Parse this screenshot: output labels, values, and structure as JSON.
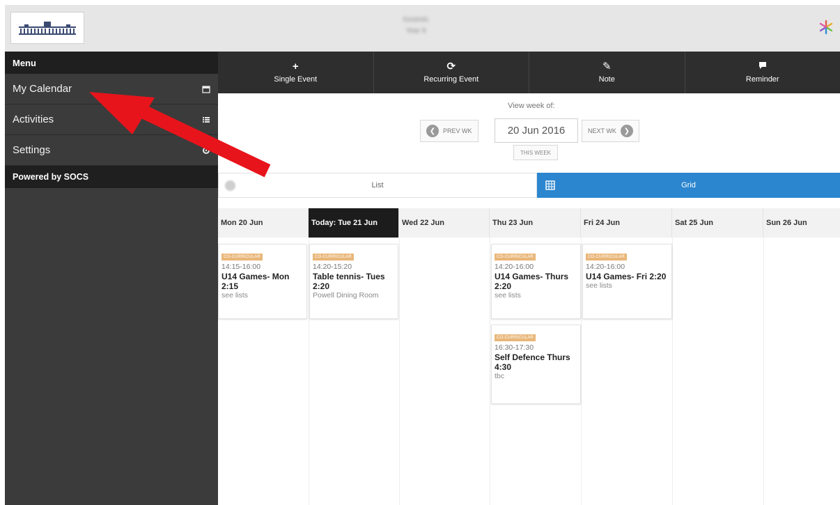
{
  "header": {
    "school_line1": "Kestrels",
    "school_line2": "Year 9"
  },
  "sidebar": {
    "menu_label": "Menu",
    "items": [
      {
        "label": "My Calendar",
        "icon": "calendar-icon"
      },
      {
        "label": "Activities",
        "icon": "list-icon"
      },
      {
        "label": "Settings",
        "icon": "gear-icon"
      }
    ],
    "powered_by": "Powered by SOCS"
  },
  "toolbar": {
    "items": [
      {
        "label": "Single Event",
        "icon": "plus-icon"
      },
      {
        "label": "Recurring Event",
        "icon": "refresh-icon"
      },
      {
        "label": "Note",
        "icon": "pencil-icon"
      },
      {
        "label": "Reminder",
        "icon": "speech-bubble-icon"
      }
    ]
  },
  "week_nav": {
    "view_week_label": "View week of:",
    "prev_label": "PREV WK",
    "date_value": "20 Jun 2016",
    "next_label": "NEXT WK",
    "this_week_label": "THIS WEEK"
  },
  "view_toggle": {
    "list_label": "List",
    "grid_label": "Grid",
    "active": "Grid"
  },
  "calendar": {
    "days": [
      {
        "label": "Mon 20 Jun"
      },
      {
        "label": "Today: Tue 21 Jun"
      },
      {
        "label": "Wed 22 Jun"
      },
      {
        "label": "Thu 23 Jun"
      },
      {
        "label": "Fri 24 Jun"
      },
      {
        "label": "Sat 25 Jun"
      },
      {
        "label": "Sun 26 Jun"
      }
    ],
    "events": [
      {
        "tag": "CO-CURRICULAR",
        "time": "14:15-16:00",
        "title": "U14 Games- Mon 2:15",
        "location": "see lists"
      },
      {
        "tag": "CO-CURRICULAR",
        "time": "14:20-15:20",
        "title": "Table tennis- Tues 2:20",
        "location": "Powell Dining Room"
      },
      {
        "tag": "CO-CURRICULAR",
        "time": "14:20-16:00",
        "title": "U14 Games- Thurs 2:20",
        "location": "see lists"
      },
      {
        "tag": "CO-CURRICULAR",
        "time": "14:20-16:00",
        "title": "U14 Games- Fri 2:20",
        "location": "see lists"
      },
      {
        "tag": "CO-CURRICULAR",
        "time": "16:30-17:30",
        "title": "Self Defence Thurs 4:30",
        "location": "tbc"
      }
    ]
  },
  "colors": {
    "accent": "#2b86cf",
    "sidebar": "#3b3b3b",
    "toolbar": "#2e2e2e",
    "tag": "#e9b77a",
    "arrow": "#e8141b"
  }
}
